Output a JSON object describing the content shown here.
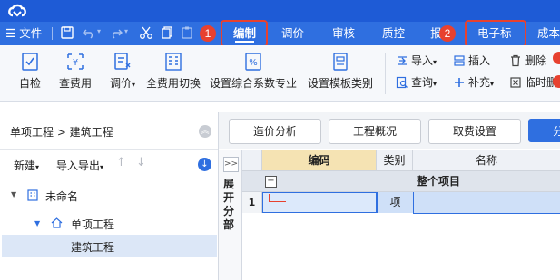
{
  "menu": {
    "file_label": "文件",
    "tabs": [
      {
        "label": "编制",
        "active": true
      },
      {
        "label": "调价",
        "active": false
      },
      {
        "label": "审核",
        "active": false
      },
      {
        "label": "质控",
        "active": false
      },
      {
        "label": "报",
        "active": false
      },
      {
        "label": "电子标",
        "active": false
      },
      {
        "label": "成本",
        "active": false
      }
    ],
    "badges": [
      "1",
      "2"
    ]
  },
  "ribbon": {
    "big_buttons": [
      {
        "label": "自检",
        "icon": "self-check-icon"
      },
      {
        "label": "查费用",
        "icon": "check-fee-icon"
      },
      {
        "label": "调价",
        "icon": "adjust-price-icon",
        "dropdown": true
      },
      {
        "label": "全费用切换",
        "icon": "full-cost-switch-icon"
      },
      {
        "label": "设置综合系数专业",
        "icon": "coefficient-icon"
      },
      {
        "label": "设置模板类别",
        "icon": "template-icon"
      }
    ],
    "small_buttons": [
      {
        "label": "导入",
        "icon": "import-icon",
        "dropdown": true
      },
      {
        "label": "插入",
        "icon": "insert-icon"
      },
      {
        "label": "删除",
        "icon": "delete-icon"
      },
      {
        "label": "查询",
        "icon": "query-icon",
        "dropdown": true
      },
      {
        "label": "补充",
        "icon": "supplement-icon",
        "dropdown": true
      },
      {
        "label": "临时删",
        "icon": "temp-delete-icon"
      }
    ]
  },
  "left_panel": {
    "breadcrumb": "单项工程 > 建筑工程",
    "toolbar": {
      "new_label": "新建",
      "import_export_label": "导入导出"
    },
    "tree": [
      {
        "label": "未命名",
        "level": 0,
        "icon": "building-icon"
      },
      {
        "label": "单项工程",
        "level": 1,
        "icon": "home-icon"
      },
      {
        "label": "建筑工程",
        "level": 2,
        "selected": true
      }
    ]
  },
  "content": {
    "tabs": [
      {
        "label": "造价分析"
      },
      {
        "label": "工程概况"
      },
      {
        "label": "取费设置"
      },
      {
        "label": "分"
      }
    ],
    "expand_label": "展开分部",
    "collapse_glyph": ">>",
    "grid": {
      "headers": [
        "编码",
        "类别",
        "名称"
      ],
      "group_row": {
        "toggle": "−",
        "label": "整个项目"
      },
      "rows": [
        {
          "num": "1",
          "code": "",
          "category": "项",
          "name": ""
        }
      ]
    }
  },
  "colors": {
    "titlebar": "#1e5bd6",
    "menubar": "#2f6fe0",
    "accent": "#e7412f",
    "selected_row": "#cfe0f8",
    "header_gold": "#f5e3b3"
  }
}
